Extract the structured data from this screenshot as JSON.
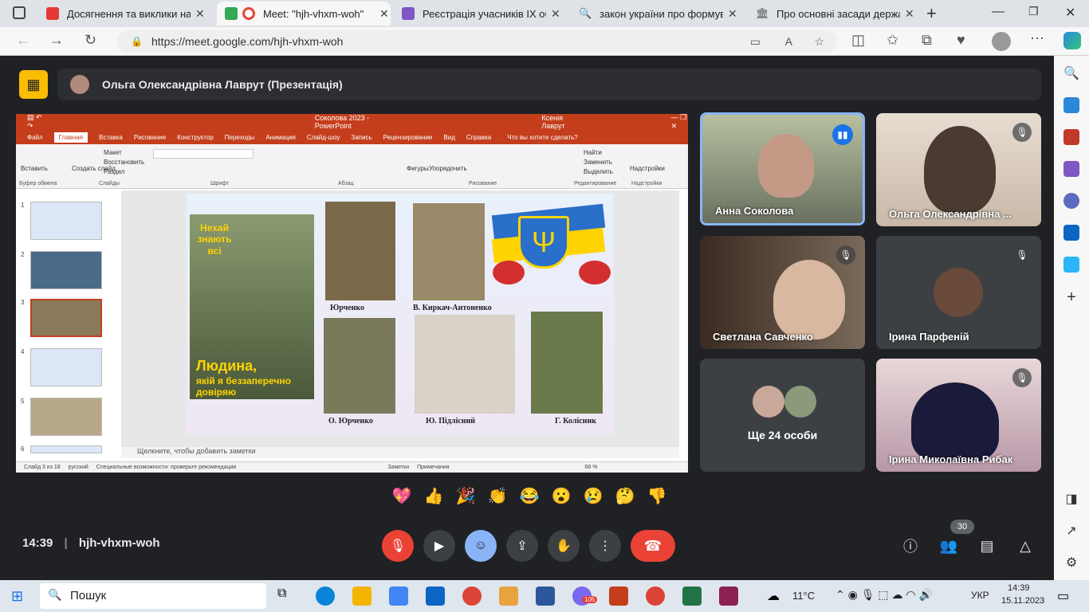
{
  "browser": {
    "tabs": [
      {
        "title": "Досягнення та виклики нац",
        "active": false
      },
      {
        "title": "Meet: \"hjh-vhxm-woh\"",
        "active": true
      },
      {
        "title": "Реєстрація учасників IX обл",
        "active": false
      },
      {
        "title": "закон україни про формува",
        "active": false
      },
      {
        "title": "Про основні засади держав",
        "active": false
      }
    ],
    "url": "https://meet.google.com/hjh-vhxm-woh"
  },
  "meet": {
    "presenter_label": "Ольга Олександрівна Лаврут (Презентація)",
    "meeting_code": "hjh-vhxm-woh",
    "time": "14:39",
    "participant_count": "30",
    "tiles": [
      {
        "name": "Анна Соколова"
      },
      {
        "name": "Ольга Олександрівна ..."
      },
      {
        "name": "Светлана Савченко"
      },
      {
        "name": "Ірина Парфеній"
      },
      {
        "name": "Ще 24 особи"
      },
      {
        "name": "Ірина Миколаївна Рибак"
      }
    ],
    "reactions": [
      "💖",
      "👍",
      "🎉",
      "👏",
      "😂",
      "😮",
      "😢",
      "🤔",
      "👎"
    ]
  },
  "powerpoint": {
    "title": "Соколова 2023  -  PowerPoint",
    "user": "Ксенія Лаврут",
    "search": "Что вы хотите сделать?",
    "menu": [
      "Файл",
      "Главная",
      "Вставка",
      "Рисование",
      "Конструктор",
      "Переходы",
      "Анимация",
      "Слайд-шоу",
      "Запись",
      "Рецензирование",
      "Вид",
      "Справка"
    ],
    "groups": [
      "Буфер обмена",
      "Слайды",
      "Шрифт",
      "Абзац",
      "Рисование",
      "Редактирование",
      "Надстройки"
    ],
    "ribbon_buttons": {
      "paste": "Вставить",
      "new_slide": "Создать слайд",
      "layout": "Макет",
      "reset": "Восстановить",
      "section": "Раздел",
      "shapes": "Фигуры",
      "arrange": "Упорядочить",
      "find": "Найти",
      "replace": "Заменить",
      "select": "Выделить",
      "addins": "Надстройки"
    },
    "thumb_numbers": [
      "1",
      "2",
      "3",
      "4",
      "5",
      "6"
    ],
    "notes_placeholder": "Щелкните, чтобы добавить заметки",
    "status": {
      "slide": "Слайд 3 из 18",
      "lang": "русский",
      "access": "Специальные возможности: проверьте рекомендации",
      "notes": "Заметки",
      "comments": "Примечания",
      "zoom": "68 %"
    },
    "slide": {
      "banner_top": "Нехай знають всі",
      "headline": "Людина,",
      "subline": "якій я беззаперечно довіряю",
      "captions": [
        "Юрченко",
        "В. Киркач-Антоненко",
        "О. Юрченко",
        "Ю. Підлісний",
        "Г. Колісник"
      ]
    }
  },
  "taskbar": {
    "search": "Пошук",
    "weather": "11°C",
    "lang": "УКР",
    "time": "14:39",
    "date": "15.11.2023",
    "outlook_badge": "105"
  }
}
